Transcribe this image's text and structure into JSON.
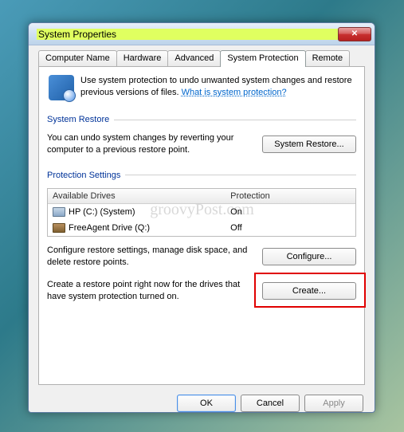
{
  "window": {
    "title": "System Properties"
  },
  "tabs": [
    {
      "label": "Computer Name"
    },
    {
      "label": "Hardware"
    },
    {
      "label": "Advanced"
    },
    {
      "label": "System Protection"
    },
    {
      "label": "Remote"
    }
  ],
  "info": {
    "text1": "Use system protection to undo unwanted system changes and restore previous versions of files. ",
    "link": "What is system protection?"
  },
  "restore": {
    "group": "System Restore",
    "text": "You can undo system changes by reverting your computer to a previous restore point.",
    "button": "System Restore..."
  },
  "protection": {
    "group": "Protection Settings",
    "header_drives": "Available Drives",
    "header_protection": "Protection",
    "drives": [
      {
        "name": "HP (C:) (System)",
        "status": "On"
      },
      {
        "name": "FreeAgent Drive (Q:)",
        "status": "Off"
      }
    ],
    "configure_text": "Configure restore settings, manage disk space, and delete restore points.",
    "configure_button": "Configure...",
    "create_text": "Create a restore point right now for the drives that have system protection turned on.",
    "create_button": "Create..."
  },
  "buttons": {
    "ok": "OK",
    "cancel": "Cancel",
    "apply": "Apply"
  },
  "watermark": "groovyPost.com"
}
